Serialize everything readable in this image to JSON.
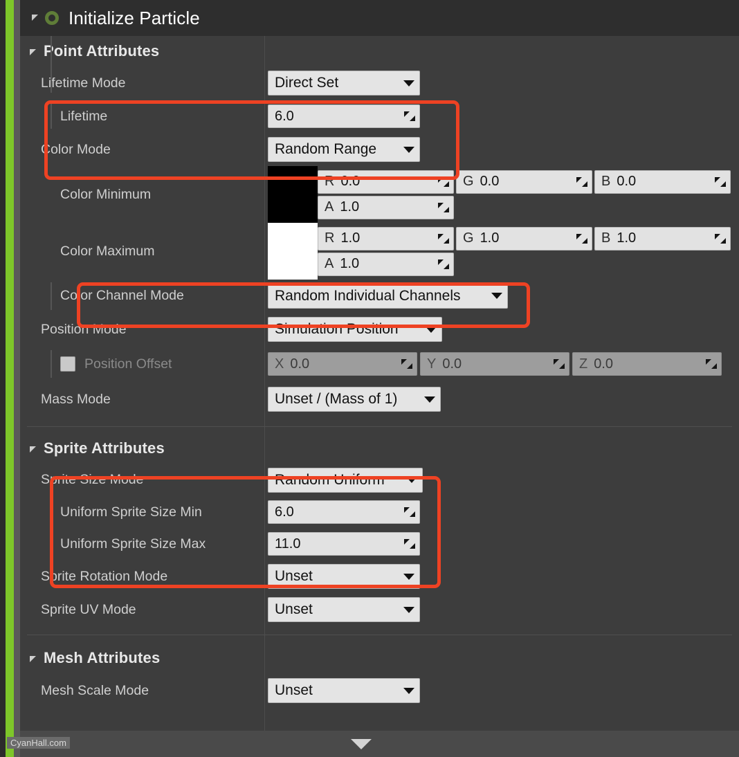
{
  "accent": {
    "green_bar": "#7ec62a",
    "highlight": "#ee4223",
    "panel_bg": "#3d3d3d",
    "header_bg": "#2e2e2e"
  },
  "module": {
    "title": "Initialize Particle",
    "caret_icon": "triangle-down-icon",
    "status_icon": "green-ring-icon"
  },
  "sections": {
    "point": {
      "title": "Point Attributes",
      "rows": {
        "lifetime_mode": {
          "label": "Lifetime Mode",
          "value": "Direct Set"
        },
        "lifetime": {
          "label": "Lifetime",
          "value": "6.0"
        },
        "color_mode": {
          "label": "Color Mode",
          "value": "Random Range"
        },
        "color_minimum": {
          "label": "Color Minimum",
          "swatch": "#000000",
          "r_channel": "R",
          "r_value": "0.0",
          "g_channel": "G",
          "g_value": "0.0",
          "b_channel": "B",
          "b_value": "0.0",
          "a_channel": "A",
          "a_value": "1.0"
        },
        "color_maximum": {
          "label": "Color Maximum",
          "swatch": "#ffffff",
          "r_channel": "R",
          "r_value": "1.0",
          "g_channel": "G",
          "g_value": "1.0",
          "b_channel": "B",
          "b_value": "1.0",
          "a_channel": "A",
          "a_value": "1.0"
        },
        "color_channel_mode": {
          "label": "Color Channel Mode",
          "value": "Random Individual Channels"
        },
        "position_mode": {
          "label": "Position Mode",
          "value": "Simulation Position"
        },
        "position_offset": {
          "label": "Position Offset",
          "checked": false,
          "x_channel": "X",
          "x_value": "0.0",
          "y_channel": "Y",
          "y_value": "0.0",
          "z_channel": "Z",
          "z_value": "0.0"
        },
        "mass_mode": {
          "label": "Mass Mode",
          "value": "Unset / (Mass of 1)"
        }
      }
    },
    "sprite": {
      "title": "Sprite Attributes",
      "rows": {
        "sprite_size_mode": {
          "label": "Sprite Size Mode",
          "value": "Random Uniform"
        },
        "uniform_sprite_size_min": {
          "label": "Uniform Sprite Size Min",
          "value": "6.0"
        },
        "uniform_sprite_size_max": {
          "label": "Uniform Sprite Size Max",
          "value": "11.0"
        },
        "sprite_rotation_mode": {
          "label": "Sprite Rotation Mode",
          "value": "Unset"
        },
        "sprite_uv_mode": {
          "label": "Sprite UV Mode",
          "value": "Unset"
        }
      }
    },
    "mesh": {
      "title": "Mesh Attributes",
      "rows": {
        "mesh_scale_mode": {
          "label": "Mesh Scale Mode",
          "value": "Unset"
        }
      }
    }
  },
  "footer": {
    "expand_icon": "triangle-down-icon",
    "watermark": "CyanHall.com"
  }
}
